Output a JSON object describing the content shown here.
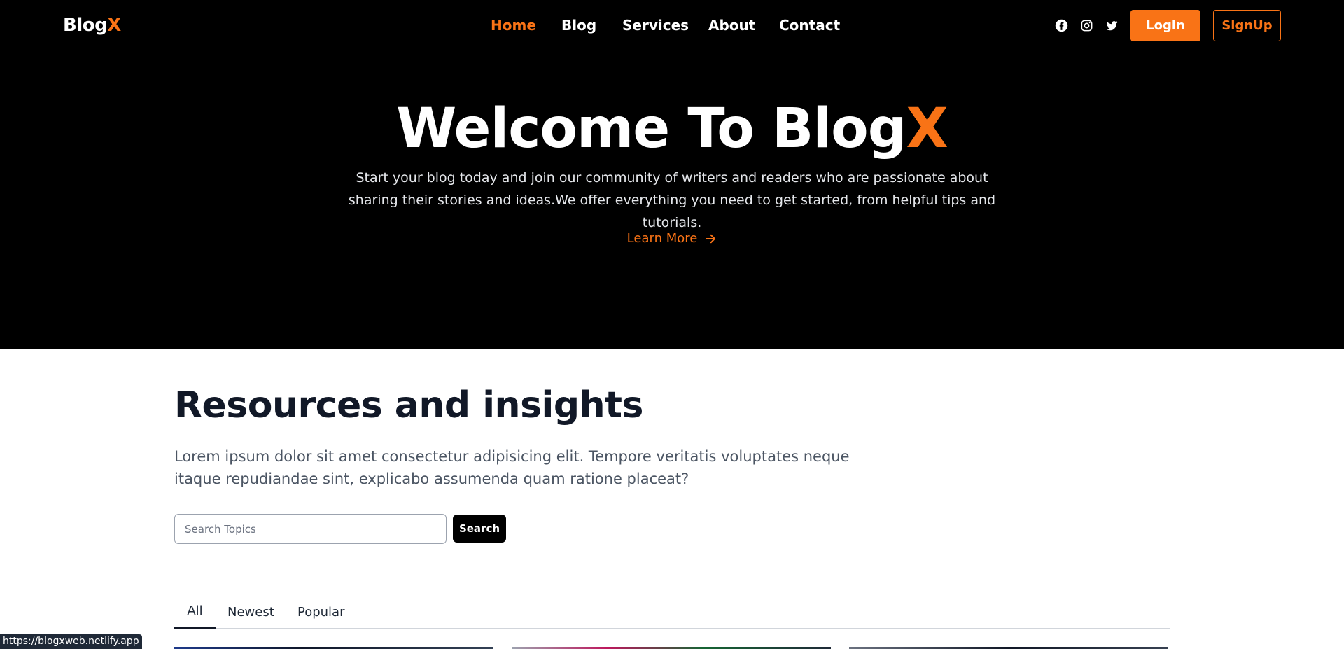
{
  "header": {
    "brand_main": "Blog",
    "brand_accent": "X",
    "nav": [
      {
        "label": "Home",
        "active": true
      },
      {
        "label": "Blog",
        "active": false
      },
      {
        "label": "Services",
        "active": false
      },
      {
        "label": "About",
        "active": false
      },
      {
        "label": "Contact",
        "active": false
      }
    ],
    "social_icons": [
      "facebook-icon",
      "instagram-icon",
      "twitter-icon"
    ],
    "login_label": "Login",
    "signup_label": "SignUp"
  },
  "hero": {
    "title_main": "Welcome To Blog",
    "title_accent": "X",
    "subtitle": "Start your blog today and join our community of writers and readers who are passionate about sharing their stories and ideas.We offer everything you need to get started, from helpful tips and tutorials.",
    "cta_label": "Learn More"
  },
  "resources": {
    "title": "Resources and insights",
    "text": "Lorem ipsum dolor sit amet consectetur adipisicing elit. Tempore veritatis voluptates neque itaque repudiandae sint, explicabo assumenda quam ratione placeat?",
    "search_placeholder": "Search Topics",
    "search_value": "",
    "search_button": "Search",
    "tabs": [
      {
        "label": "All",
        "active": true
      },
      {
        "label": "Newest",
        "active": false
      },
      {
        "label": "Popular",
        "active": false
      }
    ]
  },
  "status_bar": {
    "url": "https://blogxweb.netlify.app"
  },
  "colors": {
    "accent": "#f97316",
    "hero_bg": "#000000",
    "heading": "#111827",
    "body_text": "#4b5563"
  }
}
